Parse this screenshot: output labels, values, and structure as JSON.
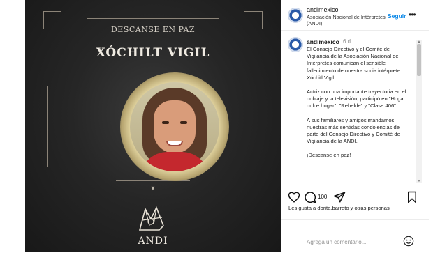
{
  "image": {
    "subtitle": "DESCANSE EN PAZ",
    "name": "XÓCHILT VIGIL",
    "logo_text": "ANDI",
    "ornament": "▼"
  },
  "header": {
    "username": "andimexico",
    "org_name": "Asociación Nacional de Intérpretes (ANDI)",
    "follow_label": "Seguir",
    "more_icon": "more-horizontal-icon"
  },
  "caption": {
    "username": "andimexico",
    "time": "6 d",
    "paragraphs": [
      "El Consejo Directivo y el Comité de Vigilancia de la Asociación Nacional de Intérpretes comunican el sensible fallecimiento de nuestra socia intérprete Xóchitl Vigil.",
      "Actriz con una importante trayectoria en el doblaje y la televisión, participó en \"Hogar dulce hogar\", \"Rebelde\" y \"Clase 406\".",
      "A sus familiares y amigos mandamos nuestras más sentidas condolencias de parte del Consejo Directivo y Comité de Vigilancia de la ANDI.",
      "¡Descanse en paz!"
    ]
  },
  "actions": {
    "like_count": "100",
    "likes_text": "Les gusta a dorita.barreto y otras personas"
  },
  "comment": {
    "placeholder": "Agrega un comentario..."
  },
  "colors": {
    "accent_blue": "#0a88e8",
    "image_bg": "#262626",
    "scarf_red": "#c4282e"
  }
}
